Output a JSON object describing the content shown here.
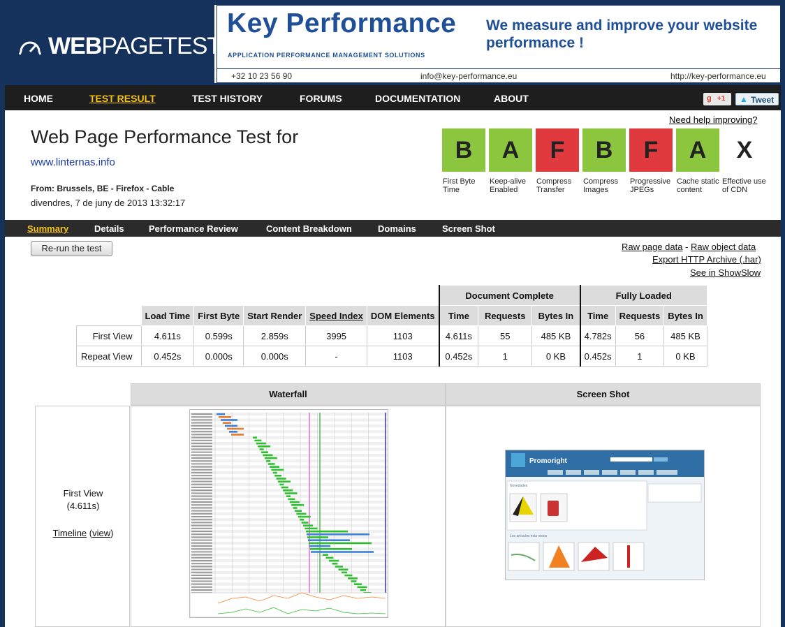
{
  "header": {
    "logo_bold": "WEB",
    "logo_thin": "PAGETEST",
    "kp_name": "Key Performance",
    "kp_subtitle": "APPLICATION PERFORMANCE MANAGEMENT SOLUTIONS",
    "kp_tagline": "We measure and improve your website performance !",
    "phone": "+32 10 23 56 90",
    "email": "info@key-performance.eu",
    "website": "http://key-performance.eu"
  },
  "nav": {
    "items": [
      "HOME",
      "TEST RESULT",
      "TEST HISTORY",
      "FORUMS",
      "DOCUMENTATION",
      "ABOUT"
    ],
    "active": "TEST RESULT",
    "gplus_g": "g",
    "gplus_count": "+1",
    "tweet_label": "Tweet"
  },
  "need_help": "Need help improving?",
  "title": "Web Page Performance Test for",
  "url": "www.linternas.info",
  "from": "From: Brussels, BE - Firefox - Cable",
  "date": "divendres, 7 de juny de 2013 13:32:17",
  "grades": [
    {
      "grade": "B",
      "label": "First Byte Time",
      "color": "#8cc63f"
    },
    {
      "grade": "A",
      "label": "Keep-alive Enabled",
      "color": "#8cc63f"
    },
    {
      "grade": "F",
      "label": "Compress Transfer",
      "color": "#e03a3e"
    },
    {
      "grade": "B",
      "label": "Compress Images",
      "color": "#8cc63f"
    },
    {
      "grade": "F",
      "label": "Progressive JPEGs",
      "color": "#e03a3e"
    },
    {
      "grade": "A",
      "label": "Cache static content",
      "color": "#8cc63f"
    },
    {
      "grade": "X",
      "label": "Effective use of CDN",
      "color": "#ffffff"
    }
  ],
  "subnav": {
    "items": [
      "Summary",
      "Details",
      "Performance Review",
      "Content Breakdown",
      "Domains",
      "Screen Shot"
    ],
    "active": "Summary"
  },
  "rerun_label": "Re-run the test",
  "links": {
    "raw_page": "Raw page data",
    "separator": " - ",
    "raw_object": "Raw object data",
    "export_har": "Export HTTP Archive (.har)",
    "showslow": "See in ShowSlow"
  },
  "summary": {
    "group_headers": [
      "Document Complete",
      "Fully Loaded"
    ],
    "columns": [
      "Load Time",
      "First Byte",
      "Start Render",
      "Speed Index",
      "DOM Elements",
      "Time",
      "Requests",
      "Bytes In",
      "Time",
      "Requests",
      "Bytes In"
    ],
    "rows": [
      {
        "label": "First View",
        "values": [
          "4.611s",
          "0.599s",
          "2.859s",
          "3995",
          "1103",
          "4.611s",
          "55",
          "485 KB",
          "4.782s",
          "56",
          "485 KB"
        ]
      },
      {
        "label": "Repeat View",
        "values": [
          "0.452s",
          "0.000s",
          "0.000s",
          "-",
          "1103",
          "0.452s",
          "1",
          "0 KB",
          "0.452s",
          "1",
          "0 KB"
        ]
      }
    ]
  },
  "waterfall": {
    "header": "Waterfall",
    "screenshot_header": "Screen Shot",
    "first_view_label": "First View",
    "first_view_time": "(4.611s)",
    "timeline_label": "Timeline",
    "view_label": "view",
    "promo_brand": "Promoright",
    "promo_section1": "Novedades",
    "promo_section2": "Los artículos más vistos"
  }
}
